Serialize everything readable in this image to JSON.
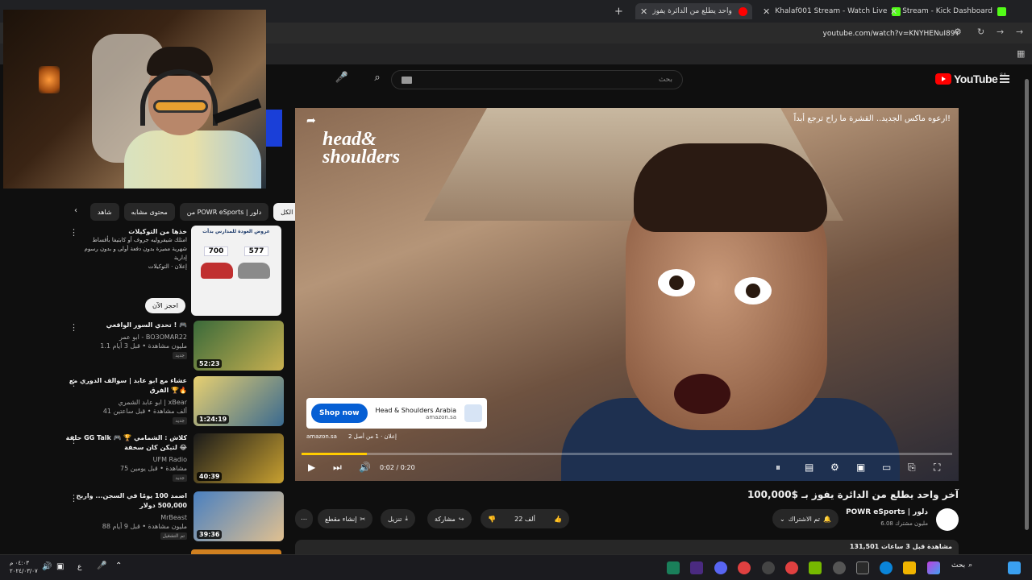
{
  "browser": {
    "tabs": [
      {
        "title": "آخر واحد يطلع من الدائرة يفوز",
        "active": true,
        "favicon_color": "#ff0000"
      },
      {
        "title": "Khalaf001 Stream - Watch Live",
        "favicon_color": "#53fc18"
      },
      {
        "title": "Stream - Kick Dashboard",
        "favicon_color": "#53fc18"
      }
    ],
    "url": "youtube.com/watch?v=KNYHENuI89Y"
  },
  "youtube": {
    "logo_text": "YouTube",
    "country_code": "SA",
    "search_placeholder": "بحث"
  },
  "sidebar": {
    "chips": [
      "الكل",
      "من POWR eSports | دلور",
      "محتوى مشابه",
      "شاهد"
    ],
    "ad": {
      "title": "خذها من التوكيلات",
      "desc": "امتلك شيفروليه جروف أو كابتيفا بأقساط شهرية مميزة بدون دفعة أولى و بدون رسوم إدارية",
      "sponsor": "إعلان · التوكيلات",
      "button": "احجز الآن",
      "thumb_header": "عروض العودة للمدارس بدأت",
      "price_left": "700",
      "price_right": "577"
    },
    "recs": [
      {
        "title": "تحدي السور الواقعي ! 🎮",
        "channel": "ابو عمر - BO3OMAR22",
        "stats": "1.1 مليون مشاهدة • قبل 3 أيام",
        "badge": "جديد",
        "duration": "52:23",
        "color": "#3a6a3a"
      },
      {
        "title": "عشاء مع ابو عابد | سوالف الدوري مع الفرق 🏆🔥",
        "channel": "ابو عابد الشمري | xBear",
        "stats": "41 ألف مشاهدة • قبل ساعتين",
        "badge": "جديد",
        "duration": "1:24:19",
        "color": "#c8a030"
      },
      {
        "title": "حلقة GG Talk 🎮 🏆 كلاش : الشمامي لتبكن كان سخفة 😂",
        "channel": "UFM Radio",
        "stats": "75 مشاهدة • قبل يومين",
        "badge": "جديد",
        "duration": "40:39",
        "color": "#2a2a2a"
      },
      {
        "title": "اصمد 100 يومًا في السجن... واربح 500,000 دولار",
        "channel": "MrBeast",
        "stats": "88 مليون مشاهدة • قبل 9 أيام",
        "badge": "تم التشغيل",
        "duration": "39:36",
        "color": "#4a80c0"
      }
    ]
  },
  "player": {
    "ad_caption": "ارعوه ماكس الجديد.. القشرة ما راح ترجع أبداً!",
    "brand_line1": "head&",
    "brand_line2": "shoulders",
    "cta_button": "Shop now",
    "cta_title": "Head & Shoulders Arabia",
    "cta_domain": "amazon.sa",
    "ad_domain": "amazon.sa",
    "ad_counter": "إعلان · 1 من أصل 2",
    "time": "0:02 / 0:20",
    "progress": 0.1
  },
  "video": {
    "title": "آخر واحد يطلع من الدائرة يفوز بـ $100,000",
    "channel": "POWR eSports | دلور",
    "subs": "6.08 مليون مشترك",
    "subscribed": "تم الاشتراك",
    "likes": "22 ألف",
    "share": "مشاركة",
    "download": "تنزيل",
    "clip": "إنشاء مقطع",
    "views": "131,501 مشاهدة قبل 3 ساعات"
  },
  "taskbar": {
    "time": "٠٤:٠٣ م",
    "date": "٢٠٢٤/٠٣/٠٧",
    "search_label": "بحث",
    "lang": "ع"
  }
}
